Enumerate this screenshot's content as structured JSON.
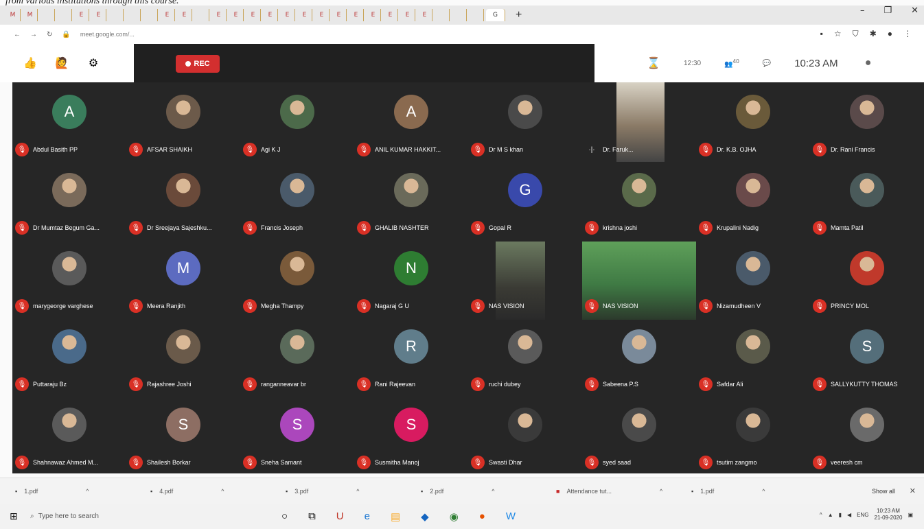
{
  "caption": "from various institutions through this course.",
  "browser": {
    "tabs": [
      "M",
      "M",
      "",
      "",
      "E",
      "E",
      "",
      "",
      "",
      "E",
      "E",
      "",
      "E",
      "E",
      "E",
      "E",
      "E",
      "E",
      "E",
      "E",
      "E",
      "E",
      "E",
      "E",
      "E",
      "",
      "",
      "",
      "G",
      "+"
    ],
    "active_tab_favicon": "G",
    "url": "meet.google.com/..."
  },
  "meet": {
    "rec_label": "REC",
    "top_right": {
      "time_counter": "12:30",
      "participants": "40",
      "clock": "10:23 AM"
    },
    "participants": [
      {
        "name": "Abdul Basith PP",
        "initial": "A",
        "color": "#3a7d5c",
        "kind": "initial"
      },
      {
        "name": "AFSAR SHAIKH",
        "initial": "",
        "color": "#6c5a4a",
        "kind": "photo"
      },
      {
        "name": "Agi K J",
        "initial": "",
        "color": "#4c6a4a",
        "kind": "photo"
      },
      {
        "name": "ANIL KUMAR HAKKIT...",
        "initial": "A",
        "color": "#8a6a4f",
        "kind": "initial"
      },
      {
        "name": "Dr M S khan",
        "initial": "",
        "color": "#4a4a4a",
        "kind": "photo"
      },
      {
        "name": "Dr. Faruk...",
        "initial": "",
        "color": "#5a5a5a",
        "kind": "video"
      },
      {
        "name": "Dr. K.B. OJHA",
        "initial": "",
        "color": "#6a5a3a",
        "kind": "photo"
      },
      {
        "name": "Dr. Rani Francis",
        "initial": "",
        "color": "#5a4a4a",
        "kind": "photo"
      },
      {
        "name": "Dr Mumtaz Begum Ga...",
        "initial": "",
        "color": "#7a6a5a",
        "kind": "photo"
      },
      {
        "name": "Dr Sreejaya Sajeshku...",
        "initial": "",
        "color": "#6a4a3a",
        "kind": "photo"
      },
      {
        "name": "Francis Joseph",
        "initial": "",
        "color": "#4a5a6a",
        "kind": "photo"
      },
      {
        "name": "GHALIB NASHTER",
        "initial": "",
        "color": "#6a6a5a",
        "kind": "photo"
      },
      {
        "name": "Gopal R",
        "initial": "G",
        "color": "#3949ab",
        "kind": "initial"
      },
      {
        "name": "krishna joshi",
        "initial": "",
        "color": "#5a6a4a",
        "kind": "photo"
      },
      {
        "name": "Krupalini Nadig",
        "initial": "",
        "color": "#6a4a4a",
        "kind": "photo"
      },
      {
        "name": "Mamta Patil",
        "initial": "",
        "color": "#4a5a5a",
        "kind": "photo"
      },
      {
        "name": "marygeorge varghese",
        "initial": "",
        "color": "#5a5a5a",
        "kind": "photo"
      },
      {
        "name": "Meera Ranjith",
        "initial": "M",
        "color": "#5c6bc0",
        "kind": "initial"
      },
      {
        "name": "Megha Thampy",
        "initial": "",
        "color": "#7a5a3a",
        "kind": "photo"
      },
      {
        "name": "Nagaraj G U",
        "initial": "N",
        "color": "#2e7d32",
        "kind": "initial"
      },
      {
        "name": "NAS VISION",
        "initial": "",
        "color": "#444",
        "kind": "video"
      },
      {
        "name": "NAS VISION",
        "initial": "",
        "color": "#444",
        "kind": "video"
      },
      {
        "name": "Nizamudheen V",
        "initial": "",
        "color": "#4a5a6a",
        "kind": "photo"
      },
      {
        "name": "PRINCY MOL",
        "initial": "",
        "color": "#c0392b",
        "kind": "photo"
      },
      {
        "name": "Puttaraju Bz",
        "initial": "",
        "color": "#4a6a8a",
        "kind": "photo"
      },
      {
        "name": "Rajashree Joshi",
        "initial": "",
        "color": "#6a5a4a",
        "kind": "photo"
      },
      {
        "name": "ranganneavar br",
        "initial": "",
        "color": "#5a6a5a",
        "kind": "photo"
      },
      {
        "name": "Rani Rajeevan",
        "initial": "R",
        "color": "#607d8b",
        "kind": "initial"
      },
      {
        "name": "ruchi dubey",
        "initial": "",
        "color": "#5a5a5a",
        "kind": "photo"
      },
      {
        "name": "Sabeena P.S",
        "initial": "",
        "color": "#7a8a9a",
        "kind": "photo"
      },
      {
        "name": "Safdar Ali",
        "initial": "",
        "color": "#5a5a4a",
        "kind": "photo"
      },
      {
        "name": "SALLYKUTTY THOMAS",
        "initial": "S",
        "color": "#546e7a",
        "kind": "initial"
      },
      {
        "name": "Shahnawaz Ahmed M...",
        "initial": "",
        "color": "#5a5a5a",
        "kind": "photo"
      },
      {
        "name": "Shailesh Borkar",
        "initial": "S",
        "color": "#8d6e63",
        "kind": "initial"
      },
      {
        "name": "Sneha Samant",
        "initial": "S",
        "color": "#ab47bc",
        "kind": "initial"
      },
      {
        "name": "Susmitha Manoj",
        "initial": "S",
        "color": "#d81b60",
        "kind": "initial"
      },
      {
        "name": "Swasti Dhar",
        "initial": "",
        "color": "#3a3a3a",
        "kind": "photo"
      },
      {
        "name": "syed saad",
        "initial": "",
        "color": "#4a4a4a",
        "kind": "photo"
      },
      {
        "name": "tsutim zangmo",
        "initial": "",
        "color": "#3a3a3a",
        "kind": "photo"
      },
      {
        "name": "veeresh cm",
        "initial": "",
        "color": "#6a6a6a",
        "kind": "photo"
      }
    ]
  },
  "downloads": {
    "items": [
      "1.pdf",
      "4.pdf",
      "3.pdf",
      "2.pdf",
      "Attendance tut...",
      "1.pdf"
    ],
    "show_all": "Show all"
  },
  "taskbar": {
    "search_placeholder": "Type here to search",
    "time": "10:23 AM",
    "date": "21-09-2020",
    "lang": "ENG"
  }
}
